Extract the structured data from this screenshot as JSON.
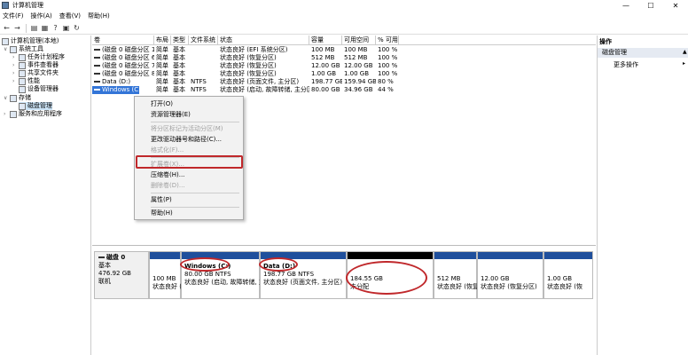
{
  "window": {
    "title": "计算机管理",
    "min": "—",
    "max": "☐",
    "close": "✕"
  },
  "menu": [
    "文件(F)",
    "操作(A)",
    "查看(V)",
    "帮助(H)"
  ],
  "toolbar_icons": [
    "back-icon",
    "forward-icon",
    "up-folder-icon",
    "properties-icon",
    "help-icon",
    "export-list-icon",
    "refresh-icon"
  ],
  "tree": {
    "root": "计算机管理(本地)",
    "system_tools": "系统工具",
    "task_scheduler": "任务计划程序",
    "event_viewer": "事件查看器",
    "shared_folders": "共享文件夹",
    "performance": "性能",
    "device_manager": "设备管理器",
    "storage": "存储",
    "disk_management": "磁盘管理",
    "services": "服务和应用程序"
  },
  "volumes": {
    "headers": [
      "卷",
      "布局",
      "类型",
      "文件系统",
      "状态",
      "容量",
      "可用空间",
      "% 可用"
    ],
    "rows": [
      [
        "(磁盘 0 磁盘分区 1)",
        "简单",
        "基本",
        "",
        "状态良好 (EFI 系统分区)",
        "100 MB",
        "100 MB",
        "100 %"
      ],
      [
        "(磁盘 0 磁盘分区 6)",
        "简单",
        "基本",
        "",
        "状态良好 (恢复分区)",
        "512 MB",
        "512 MB",
        "100 %"
      ],
      [
        "(磁盘 0 磁盘分区 7)",
        "简单",
        "基本",
        "",
        "状态良好 (恢复分区)",
        "12.00 GB",
        "12.00 GB",
        "100 %"
      ],
      [
        "(磁盘 0 磁盘分区 8)",
        "简单",
        "基本",
        "",
        "状态良好 (恢复分区)",
        "1.00 GB",
        "1.00 GB",
        "100 %"
      ],
      [
        "Data (D:)",
        "简单",
        "基本",
        "NTFS",
        "状态良好 (页面文件, 主分区)",
        "198.77 GB",
        "159.94 GB",
        "80 %"
      ],
      [
        "Windows (C:)",
        "简单",
        "基本",
        "NTFS",
        "状态良好 (启动, 故障转储, 主分区)",
        "80.00 GB",
        "34.96 GB",
        "44 %"
      ]
    ]
  },
  "context_menu": {
    "open": "打开(O)",
    "explorer": "资源管理器(E)",
    "mark_active": "将分区标记为活动分区(M)",
    "change_letter": "更改驱动器号和路径(C)...",
    "format": "格式化(F)...",
    "extend": "扩展卷(X)...",
    "shrink": "压缩卷(H)...",
    "delete": "删除卷(D)...",
    "properties": "属性(P)",
    "help": "帮助(H)"
  },
  "disk": {
    "name": "磁盘 0",
    "type": "基本",
    "size": "476.92 GB",
    "status": "联机",
    "partitions": [
      {
        "l1": "100 MB",
        "l2": "状态良好 (EFI"
      },
      {
        "l0": "Windows  (C:)",
        "l1": "80.00 GB NTFS",
        "l2": "状态良好 (启动, 故障转储, 主"
      },
      {
        "l0": "Data  (D:)",
        "l1": "198.77 GB NTFS",
        "l2": "状态良好 (页面文件, 主分区)"
      },
      {
        "l1": "184.55 GB",
        "l2": "未分配"
      },
      {
        "l1": "512 MB",
        "l2": "状态良好 (恢复"
      },
      {
        "l1": "12.00 GB",
        "l2": "状态良好 (恢复分区)"
      },
      {
        "l1": "1.00 GB",
        "l2": "状态良好 (恢"
      }
    ]
  },
  "actions": {
    "header": "操作",
    "section": "磁盘管理",
    "more": "更多操作"
  },
  "colors": {
    "selection": "#3375d7",
    "partition_bar": "#1f4f9c",
    "highlight": "#c0282b"
  }
}
